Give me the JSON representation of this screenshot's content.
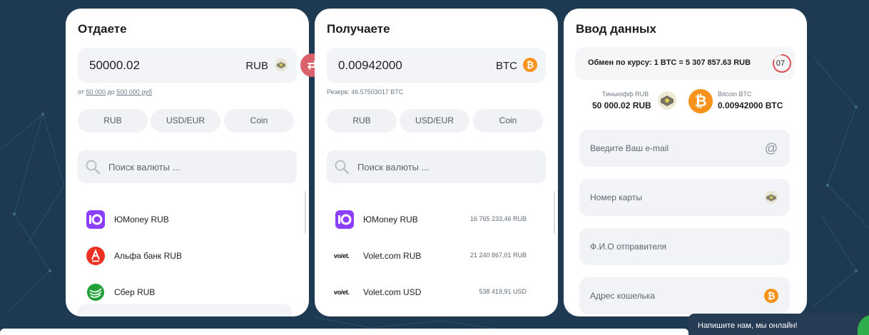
{
  "colors": {
    "background": "#1d3a52",
    "panel": "#ffffff",
    "accent_swap": "#d9626c",
    "bitcoin": "#f7931a",
    "chat_bg": "#263b54"
  },
  "give": {
    "title": "Отдаете",
    "amount": "50000.02",
    "currency": "RUB",
    "currency_icon": "tinkoff-bank-icon",
    "hint_from": "от",
    "hint_min": "50 000",
    "hint_to": "до",
    "hint_max": "500 000 руб",
    "tabs": [
      "RUB",
      "USD/EUR",
      "Coin"
    ],
    "search_placeholder": "Поиск валюты ...",
    "items": [
      {
        "name": "ЮMoney RUB",
        "icon": "yoomoney-icon"
      },
      {
        "name": "Альфа банк RUB",
        "icon": "alfa-bank-icon"
      },
      {
        "name": "Сбер RUB",
        "icon": "sber-icon"
      }
    ]
  },
  "swap": {
    "icon": "swap-arrows-icon",
    "glyph": "⇄"
  },
  "get": {
    "title": "Получаете",
    "amount": "0.00942000",
    "currency": "BTC",
    "currency_icon": "bitcoin-icon",
    "reserve": "Резерв: 46.57503017 BTC",
    "tabs": [
      "RUB",
      "USD/EUR",
      "Coin"
    ],
    "search_placeholder": "Поиск валюты ...",
    "items": [
      {
        "name": "ЮMoney RUB",
        "amount": "16 765 233,46 RUB",
        "icon": "yoomoney-icon",
        "logo_text": ""
      },
      {
        "name": "Volet.com RUB",
        "amount": "21 240 867,01 RUB",
        "icon": "volet-logo",
        "logo_text": "vo/et."
      },
      {
        "name": "Volet.com USD",
        "amount": "538 419,91 USD",
        "icon": "volet-logo",
        "logo_text": "vo/et."
      }
    ]
  },
  "data": {
    "title": "Ввод данных",
    "rate_text": "Обмен по курсу: 1 BTC = 5 307 857.63 RUB",
    "timer": "07",
    "timer_fraction": 0.8,
    "from_label": "Тинькофф RUB",
    "from_value": "50 000.02 RUB",
    "to_label": "Bitcoin BTC",
    "to_value": "0.00942000 BTC",
    "fields": [
      {
        "placeholder": "Введите Ваш e-mail",
        "icon": "at-sign-icon",
        "glyph": "@"
      },
      {
        "placeholder": "Номер карты",
        "icon": "tinkoff-bank-icon",
        "glyph": ""
      },
      {
        "placeholder": "Ф.И.О отправителя",
        "icon": "",
        "glyph": ""
      },
      {
        "placeholder": "Адрес кошелька",
        "icon": "bitcoin-icon",
        "glyph": ""
      }
    ]
  },
  "chat": {
    "text": "Напишите нам, мы онлайн!",
    "icon": "leaf-icon"
  }
}
